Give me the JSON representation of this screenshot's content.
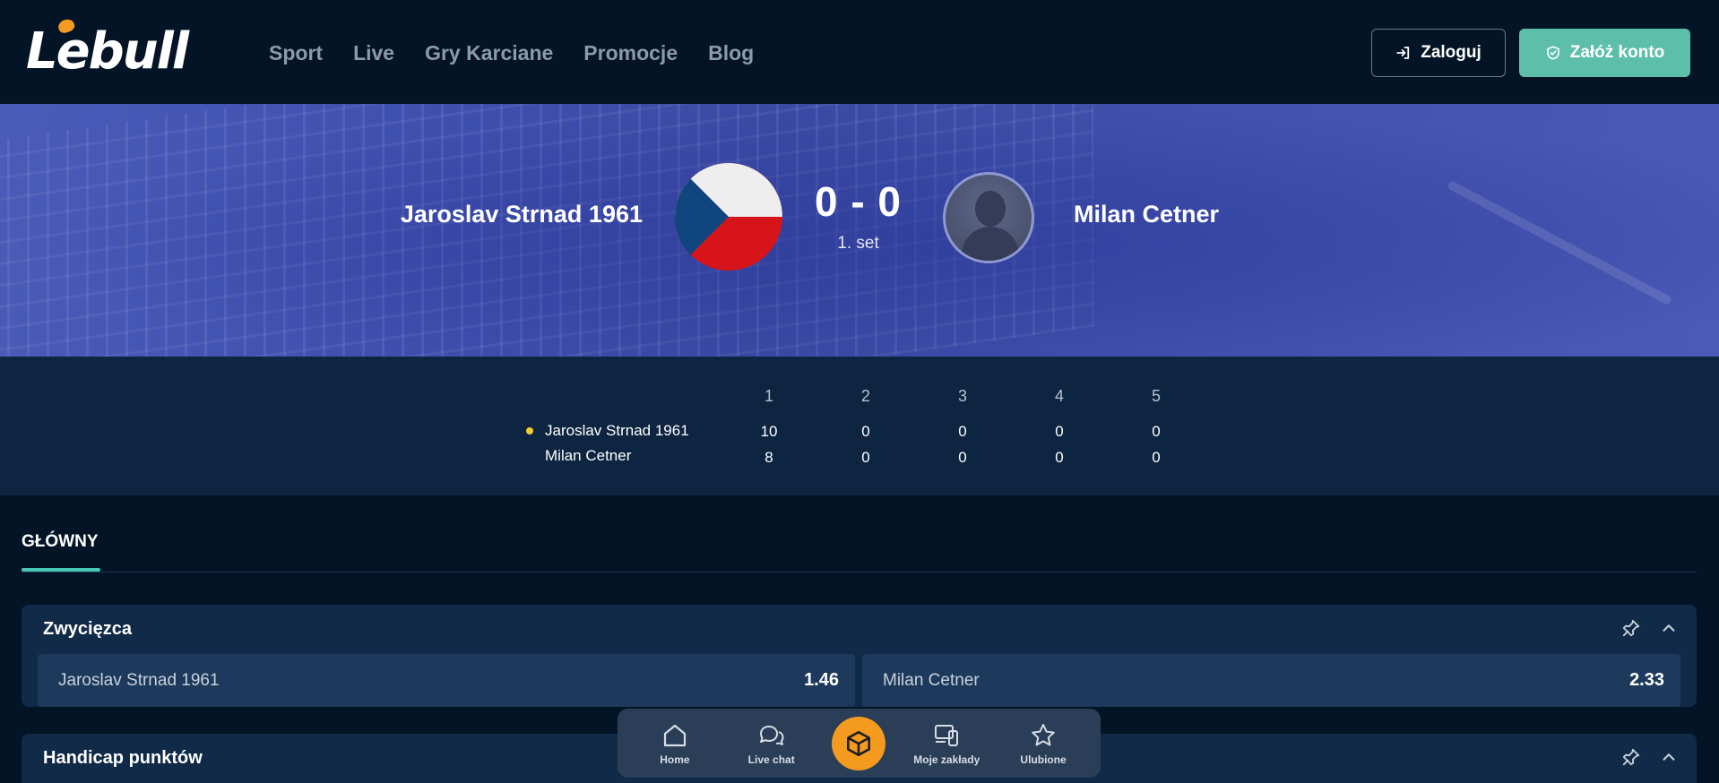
{
  "header": {
    "logo": "Lebull",
    "nav": [
      "Sport",
      "Live",
      "Gry Karciane",
      "Promocje",
      "Blog"
    ],
    "login_label": "Zaloguj",
    "register_label": "Załóż konto"
  },
  "match": {
    "player1": "Jaroslav Strnad 1961",
    "player2": "Milan Cetner",
    "score": "0 - 0",
    "period": "1. set",
    "player1_flag": "czech-flag-icon",
    "player2_avatar": "user-placeholder-icon"
  },
  "scoreboard": {
    "sets": [
      "1",
      "2",
      "3",
      "4",
      "5"
    ],
    "rows": [
      {
        "name": "Jaroslav Strnad 1961",
        "serving": true,
        "scores": [
          "10",
          "0",
          "0",
          "0",
          "0"
        ]
      },
      {
        "name": "Milan Cetner",
        "serving": false,
        "scores": [
          "8",
          "0",
          "0",
          "0",
          "0"
        ]
      }
    ]
  },
  "tabs": {
    "main": "GŁÓWNY"
  },
  "markets": [
    {
      "title": "Zwycięzca",
      "odds": [
        {
          "name": "Jaroslav Strnad 1961",
          "value": "1.46"
        },
        {
          "name": "Milan Cetner",
          "value": "2.33"
        }
      ]
    },
    {
      "title": "Handicap punktów",
      "odds": []
    }
  ],
  "bottom_nav": {
    "home": "Home",
    "live_chat": "Live chat",
    "center_icon": "cube-icon",
    "my_bets": "Moje zakłady",
    "favorites": "Ulubione"
  },
  "colors": {
    "background": "#031427",
    "accent": "#5dbfa9",
    "tab_underline": "#45c7b1",
    "serving_dot": "#f5cf2b",
    "center_button": "#f39a1f"
  }
}
